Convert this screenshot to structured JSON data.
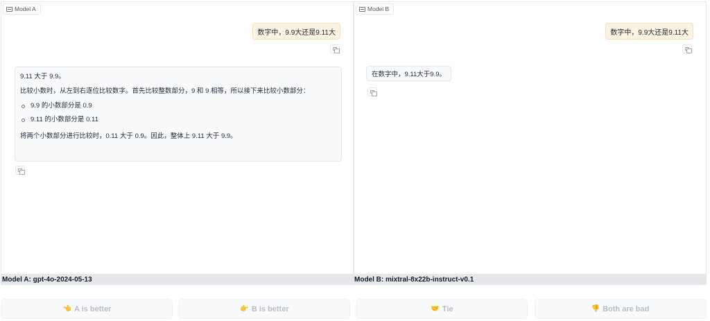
{
  "panel_a": {
    "tag": "Model A",
    "user_message": "数字中，9.9大还是9.11大",
    "reply": {
      "line1": "9.11 大于 9.9。",
      "line2": "比较小数时，从左到右逐位比较数字。首先比较整数部分，9 和 9 相等，所以接下来比较小数部分：",
      "bullets": [
        "9.9 的小数部分是 0.9",
        "9.11 的小数部分是 0.11"
      ],
      "line3": "将两个小数部分进行比较时，0.11 大于 0.9。因此，整体上 9.11 大于 9.9。"
    },
    "model_label": "Model A: gpt-4o-2024-05-13"
  },
  "panel_b": {
    "tag": "Model B",
    "user_message": "数字中，9.9大还是9.11大",
    "reply": "在数字中，9.11大于9.9。",
    "model_label": "Model B: mixtral-8x22b-instruct-v0.1"
  },
  "votes": {
    "a_better": "A is better",
    "b_better": "B is better",
    "tie": "Tie",
    "both_bad": "Both are bad"
  },
  "icons": {
    "a_better": "👈",
    "b_better": "👉",
    "tie": "🤝",
    "both_bad": "👎"
  }
}
